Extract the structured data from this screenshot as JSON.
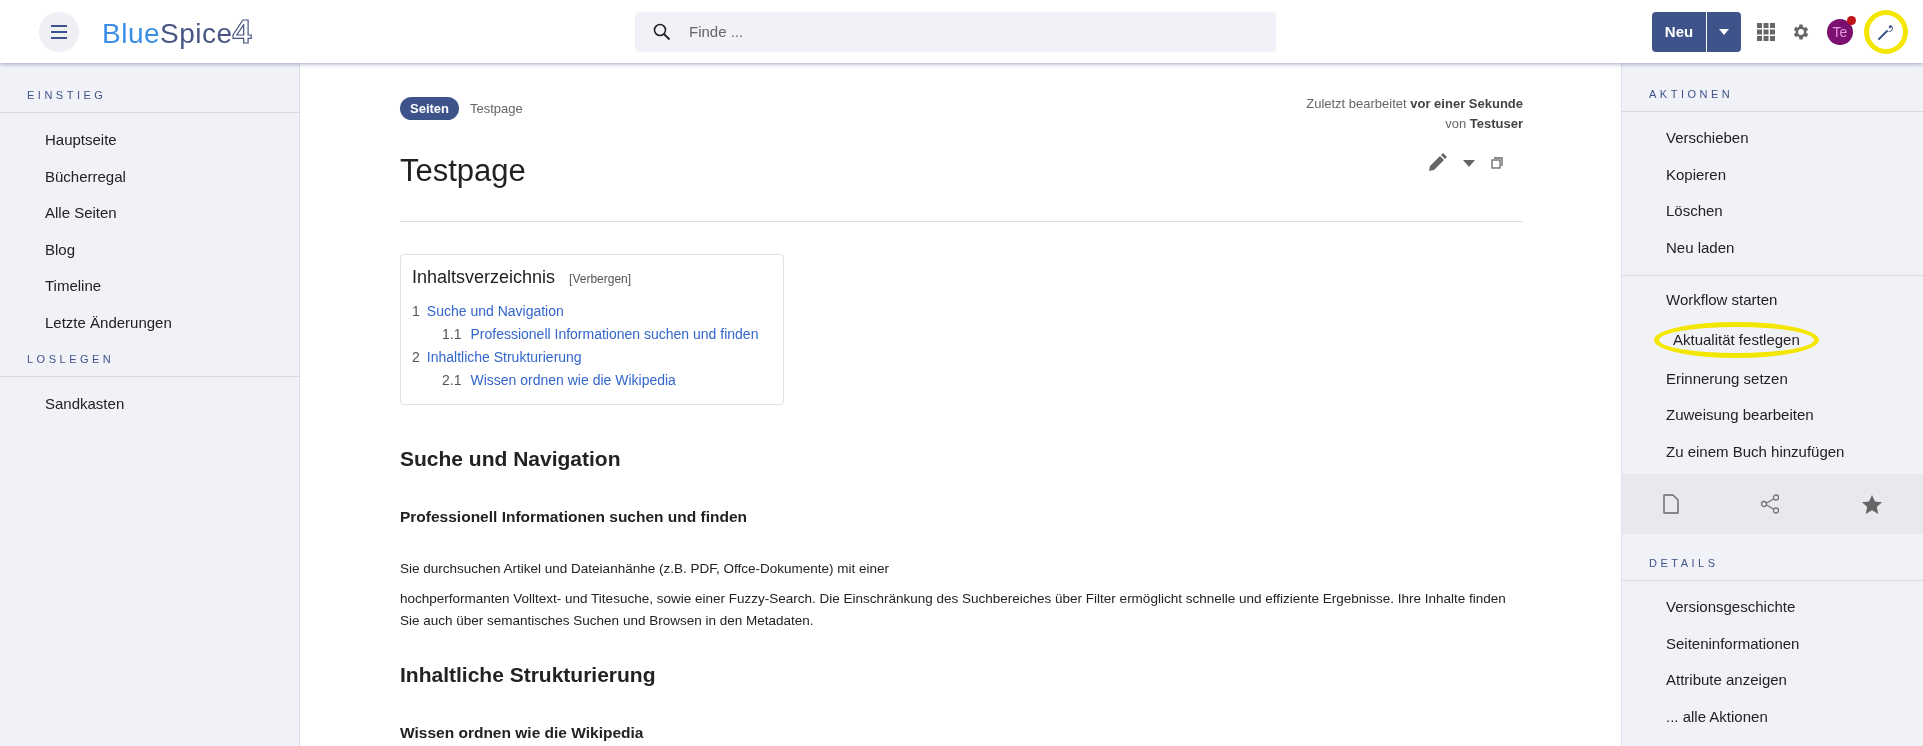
{
  "header": {
    "logo": {
      "word_a": "Blue",
      "word_b": "Spice",
      "numeral": "4"
    },
    "search": {
      "placeholder": "Finde ..."
    },
    "new_button": {
      "label": "Neu"
    },
    "avatar": {
      "initials": "Te",
      "notification": true
    },
    "tools_button": {
      "highlighted": true
    }
  },
  "left_sidebar": {
    "sections": [
      {
        "title": "EINSTIEG",
        "items": [
          {
            "label": "Hauptseite"
          },
          {
            "label": "Bücherregal"
          },
          {
            "label": "Alle Seiten"
          },
          {
            "label": "Blog"
          },
          {
            "label": "Timeline"
          },
          {
            "label": "Letzte Änderungen"
          }
        ]
      },
      {
        "title": "LOSLEGEN",
        "items": [
          {
            "label": "Sandkasten"
          }
        ]
      }
    ]
  },
  "page": {
    "namespace_badge": "Seiten",
    "breadcrumb": "Testpage",
    "last_edit": {
      "line_1": "Zuletzt bearbeitet **vor einer Sekunde**",
      "line_2": "von **Testuser**"
    },
    "title": "Testpage",
    "toc": {
      "title": "Inhaltsverzeichnis",
      "toggle": "[Verbergen]",
      "entries": [
        {
          "number": "1",
          "label": "Suche und Navigation",
          "children": [
            {
              "number": "1.1",
              "label": "Professionell Informationen suchen und finden"
            }
          ]
        },
        {
          "number": "2",
          "label": "Inhaltliche Strukturierung",
          "children": [
            {
              "number": "2.1",
              "label": "Wissen ordnen wie die Wikipedia"
            }
          ]
        }
      ]
    },
    "content": [
      {
        "kind": "h2",
        "text": "Suche und Navigation"
      },
      {
        "kind": "h3",
        "text": "Professionell Informationen suchen und finden"
      },
      {
        "kind": "p",
        "text": "Sie durchsuchen Artikel und Dateianhänhe (z.B. PDF, Offce-Dokumente) mit einer"
      },
      {
        "kind": "p",
        "text": "hochperformanten Volltext- und Titesuche, sowie einer Fuzzy-Search. Die Einschränkung des Suchbereiches über Filter ermöglicht schnelle und effiziente Ergebnisse. Ihre Inhalte finden Sie auch über semantisches Suchen und Browsen in den Metadaten."
      },
      {
        "kind": "h2",
        "text": "Inhaltliche Strukturierung"
      },
      {
        "kind": "h3",
        "text": "Wissen ordnen wie die Wikipedia"
      }
    ]
  },
  "right_sidebar": {
    "actions_title": "AKTIONEN",
    "action_groups": [
      [
        {
          "label": "Verschieben",
          "highlighted": false
        },
        {
          "label": "Kopieren",
          "highlighted": false
        },
        {
          "label": "Löschen",
          "highlighted": false
        },
        {
          "label": "Neu laden",
          "highlighted": false
        }
      ],
      [
        {
          "label": "Workflow starten",
          "highlighted": false
        },
        {
          "label": "Aktualität festlegen",
          "highlighted": true
        },
        {
          "label": "Erinnerung setzen",
          "highlighted": false
        },
        {
          "label": "Zuweisung bearbeiten",
          "highlighted": false
        },
        {
          "label": "Zu einem Buch hinzufügen",
          "highlighted": false
        }
      ]
    ],
    "details_title": "DETAILS",
    "details": [
      {
        "label": "Versionsgeschichte"
      },
      {
        "label": "Seiteninformationen"
      },
      {
        "label": "Attribute anzeigen"
      },
      {
        "label": "... alle Aktionen"
      }
    ]
  }
}
